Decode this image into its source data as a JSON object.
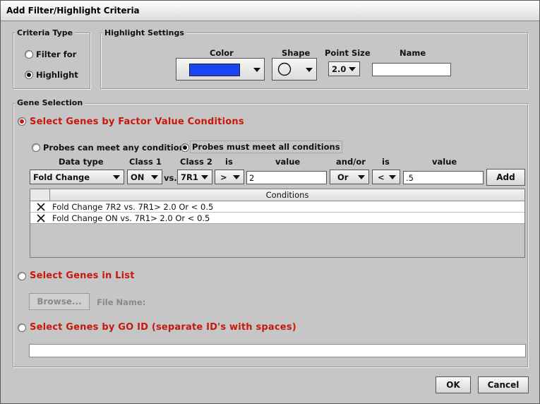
{
  "window": {
    "title": "Add Filter/Highlight Criteria"
  },
  "criteria_type": {
    "legend": "Criteria Type",
    "options": [
      {
        "label": "Filter for",
        "selected": false
      },
      {
        "label": "Highlight",
        "selected": true
      }
    ]
  },
  "highlight_settings": {
    "legend": "Highlight Settings",
    "color_label": "Color",
    "color_value": "#1a44f2",
    "shape_label": "Shape",
    "shape_value": "circle",
    "point_size_label": "Point Size",
    "point_size_value": "2.0",
    "name_label": "Name",
    "name_value": ""
  },
  "gene_selection": {
    "legend": "Gene Selection",
    "factor_option": {
      "label": "Select Genes by Factor Value Conditions",
      "selected": true
    },
    "probe_any": {
      "label": "Probes can meet any condition",
      "selected": false
    },
    "probe_all": {
      "label": "Probes must meet all conditions",
      "selected": true
    },
    "headers": {
      "data_type": "Data type",
      "class1": "Class 1",
      "class2": "Class 2",
      "is1": "is",
      "value1": "value",
      "andor": "and/or",
      "is2": "is",
      "value2": "value"
    },
    "row": {
      "data_type": "Fold Change",
      "class1": "ON",
      "vs": "vs.",
      "class2": "7R1",
      "op1": ">",
      "value1": "2",
      "andor": "Or",
      "op2": "<",
      "value2": ".5",
      "add_label": "Add"
    },
    "conditions_header": "Conditions",
    "conditions": [
      "Fold Change 7R2 vs. 7R1> 2.0 Or < 0.5",
      "Fold Change ON vs. 7R1> 2.0 Or < 0.5"
    ],
    "list_option": {
      "label": "Select Genes in List",
      "selected": false
    },
    "browse_label": "Browse...",
    "file_name_label": "File Name:",
    "go_option": {
      "label": "Select Genes by GO ID (separate ID's with spaces)",
      "selected": false
    },
    "go_input_value": ""
  },
  "buttons": {
    "ok": "OK",
    "cancel": "Cancel"
  }
}
